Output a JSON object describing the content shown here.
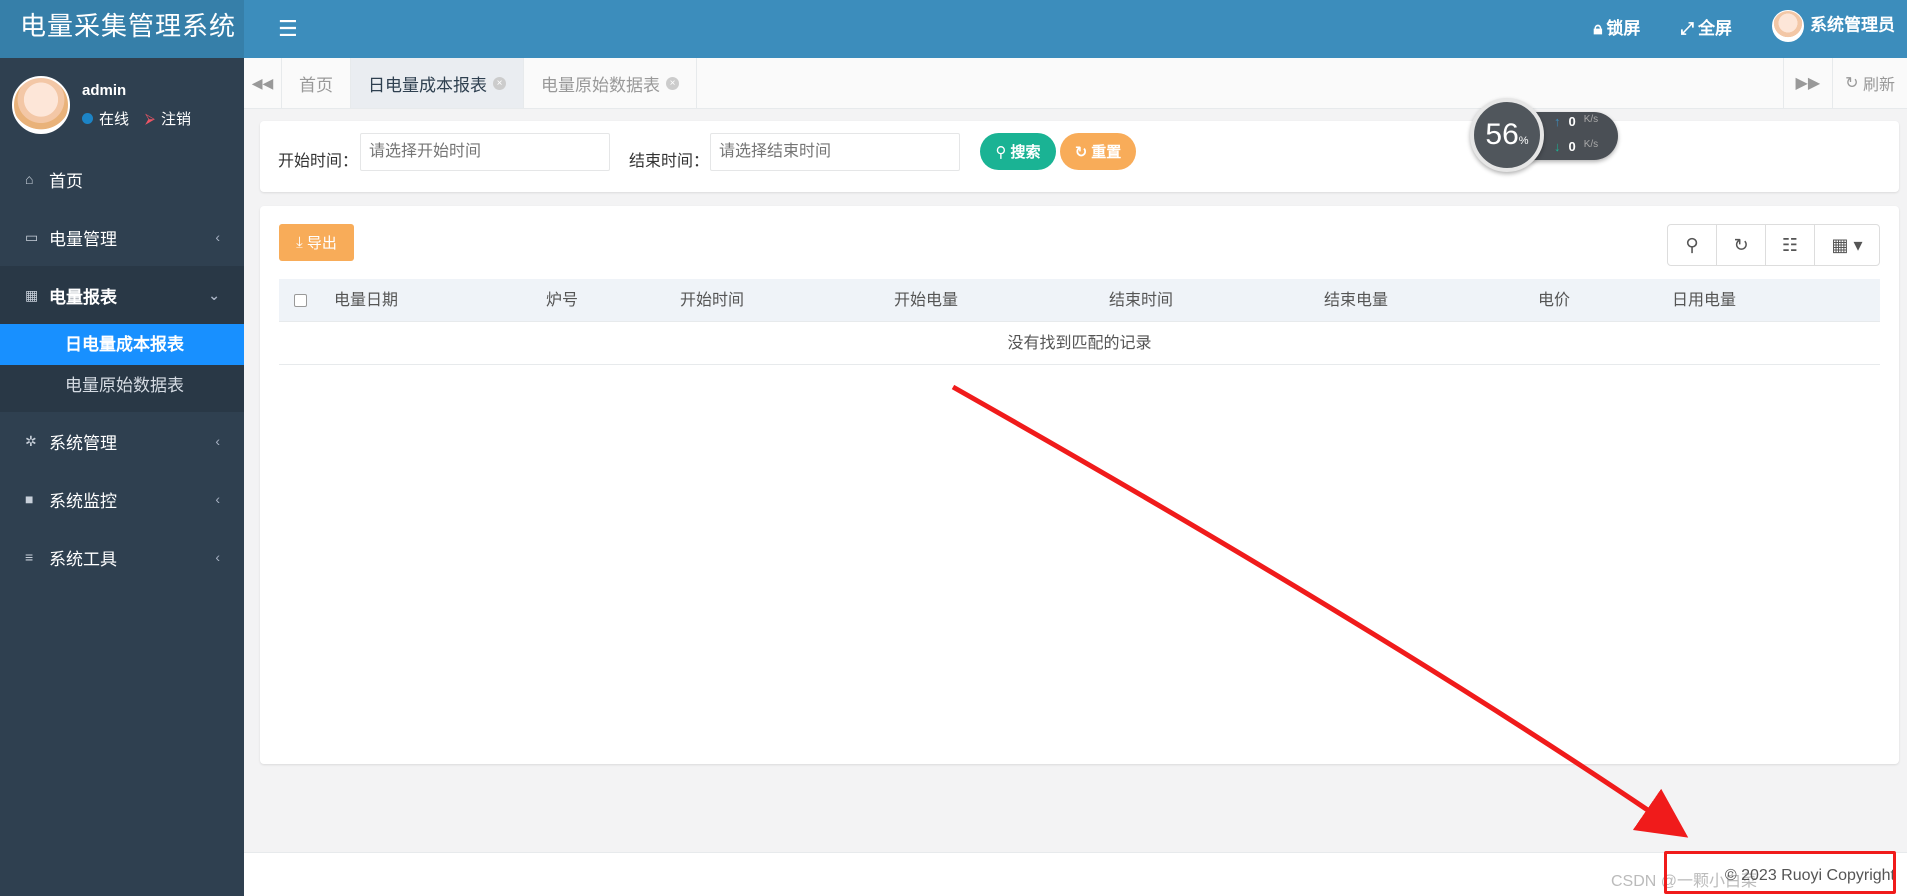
{
  "app": {
    "title": "电量采集管理系统"
  },
  "user": {
    "name": "admin",
    "online": "在线",
    "logout": "注销"
  },
  "sidebar": {
    "items": [
      {
        "label": "首页",
        "icon": "home-icon"
      },
      {
        "label": "电量管理",
        "icon": "battery-icon"
      },
      {
        "label": "电量报表",
        "icon": "calculator-icon"
      },
      {
        "label": "系统管理",
        "icon": "gear-icon"
      },
      {
        "label": "系统监控",
        "icon": "video-icon"
      },
      {
        "label": "系统工具",
        "icon": "bars-icon"
      }
    ],
    "subitems": [
      {
        "label": "日电量成本报表"
      },
      {
        "label": "电量原始数据表"
      }
    ]
  },
  "navbar": {
    "lock": "锁屏",
    "fullscreen": "全屏",
    "user": "系统管理员"
  },
  "tabs": {
    "items": [
      {
        "label": "首页"
      },
      {
        "label": "日电量成本报表"
      },
      {
        "label": "电量原始数据表"
      }
    ],
    "refresh": "刷新"
  },
  "search": {
    "start_label": "开始时间：",
    "start_placeholder": "请选择开始时间",
    "end_label": "结束时间：",
    "end_placeholder": "请选择结束时间",
    "search_btn": "搜索",
    "reset_btn": "重置"
  },
  "speed": {
    "percent": "56",
    "percent_unit": "%",
    "up": "0",
    "down": "0",
    "unit": "K/s"
  },
  "table": {
    "export_btn": "导出",
    "columns": [
      "电量日期",
      "炉号",
      "开始时间",
      "开始电量",
      "结束时间",
      "结束电量",
      "电价",
      "日用电量"
    ],
    "empty": "没有找到匹配的记录"
  },
  "footer": {
    "text": "© 2023 Ruoyi Copyright",
    "watermark": "CSDN @一颗小白菜"
  },
  "colors": {
    "sidebar": "#2f4050",
    "navbar": "#3c8dbc",
    "active": "#1890ff",
    "success": "#1ab394",
    "warning": "#f8ac59",
    "annotation": "#f01b1b"
  }
}
